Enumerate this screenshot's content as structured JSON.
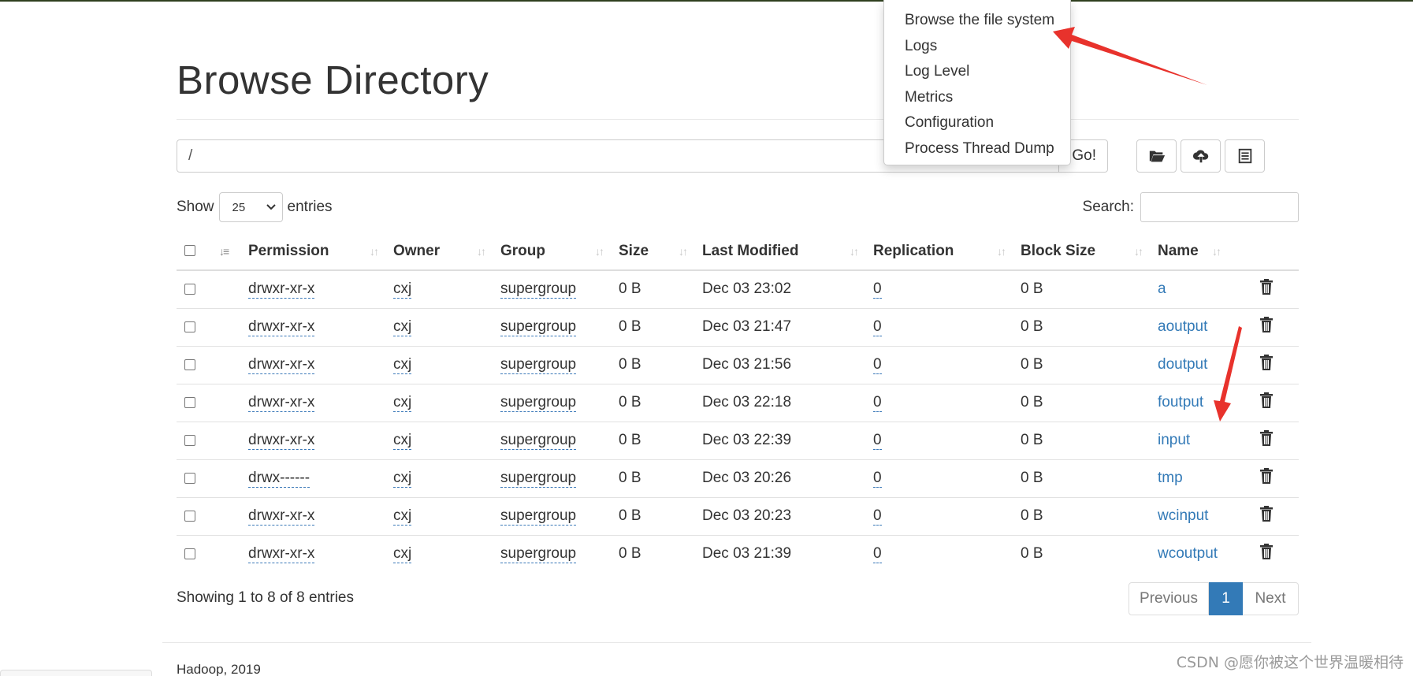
{
  "page": {
    "title": "Browse Directory",
    "footer": "Hadoop, 2019",
    "watermark": "CSDN @愿你被这个世界温暖相待"
  },
  "path_bar": {
    "value": "/",
    "go_label": "Go!",
    "icons": [
      "folder-open-icon",
      "cloud-upload-icon",
      "list-icon"
    ]
  },
  "table_controls": {
    "show_label": "Show",
    "entries_value": "25",
    "entries_label": "entries",
    "search_label": "Search:"
  },
  "table": {
    "headers": [
      "Permission",
      "Owner",
      "Group",
      "Size",
      "Last Modified",
      "Replication",
      "Block Size",
      "Name"
    ],
    "rows": [
      {
        "permission": "drwxr-xr-x",
        "owner": "cxj",
        "group": "supergroup",
        "size": "0 B",
        "modified": "Dec 03 23:02",
        "replication": "0",
        "block_size": "0 B",
        "name": "a"
      },
      {
        "permission": "drwxr-xr-x",
        "owner": "cxj",
        "group": "supergroup",
        "size": "0 B",
        "modified": "Dec 03 21:47",
        "replication": "0",
        "block_size": "0 B",
        "name": "aoutput"
      },
      {
        "permission": "drwxr-xr-x",
        "owner": "cxj",
        "group": "supergroup",
        "size": "0 B",
        "modified": "Dec 03 21:56",
        "replication": "0",
        "block_size": "0 B",
        "name": "doutput"
      },
      {
        "permission": "drwxr-xr-x",
        "owner": "cxj",
        "group": "supergroup",
        "size": "0 B",
        "modified": "Dec 03 22:18",
        "replication": "0",
        "block_size": "0 B",
        "name": "foutput"
      },
      {
        "permission": "drwxr-xr-x",
        "owner": "cxj",
        "group": "supergroup",
        "size": "0 B",
        "modified": "Dec 03 22:39",
        "replication": "0",
        "block_size": "0 B",
        "name": "input"
      },
      {
        "permission": "drwx------",
        "owner": "cxj",
        "group": "supergroup",
        "size": "0 B",
        "modified": "Dec 03 20:26",
        "replication": "0",
        "block_size": "0 B",
        "name": "tmp"
      },
      {
        "permission": "drwxr-xr-x",
        "owner": "cxj",
        "group": "supergroup",
        "size": "0 B",
        "modified": "Dec 03 20:23",
        "replication": "0",
        "block_size": "0 B",
        "name": "wcinput"
      },
      {
        "permission": "drwxr-xr-x",
        "owner": "cxj",
        "group": "supergroup",
        "size": "0 B",
        "modified": "Dec 03 21:39",
        "replication": "0",
        "block_size": "0 B",
        "name": "wcoutput"
      }
    ]
  },
  "summary": {
    "info": "Showing 1 to 8 of 8 entries",
    "previous": "Previous",
    "current_page": "1",
    "next": "Next"
  },
  "utilities_menu": {
    "items": [
      "Browse the file system",
      "Logs",
      "Log Level",
      "Metrics",
      "Configuration",
      "Process Thread Dump"
    ]
  },
  "colors": {
    "link": "#337ab7",
    "active_page": "#337ab7",
    "annotation_arrow": "#e8322c"
  }
}
